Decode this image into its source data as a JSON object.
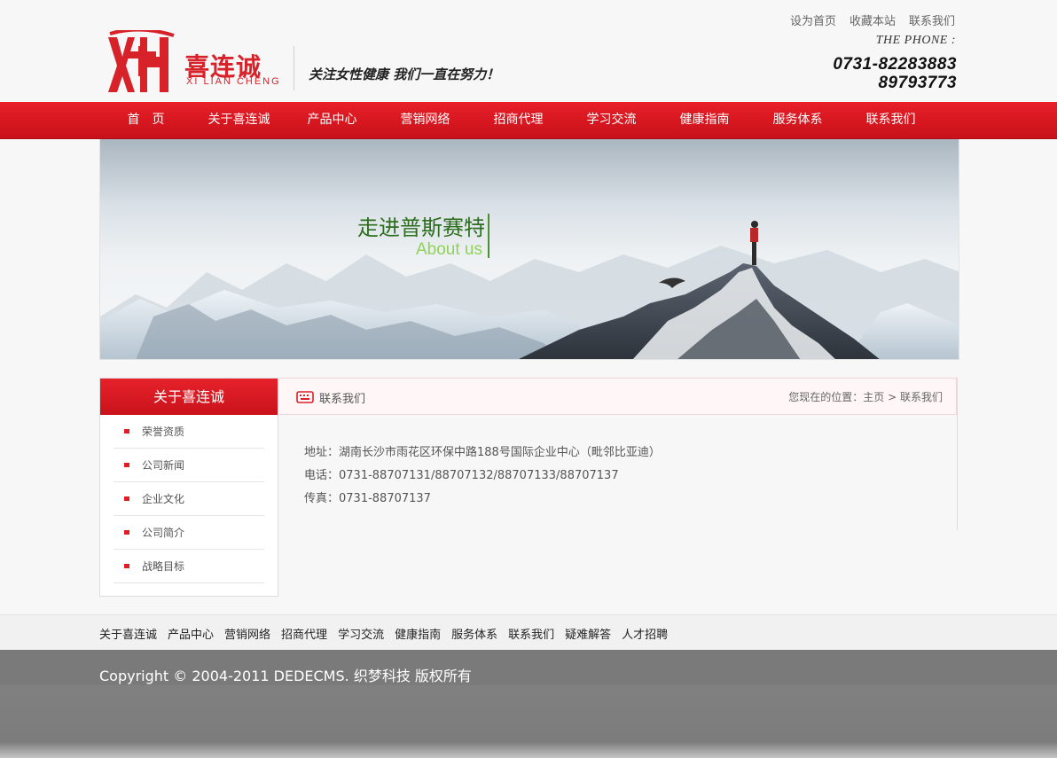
{
  "brand": {
    "name_cn": "喜连诚",
    "name_en": "XI LIAN CHENG",
    "slogan": "关注女性健康 我们一直在努力！",
    "logo_color": "#d7222a"
  },
  "top_links": [
    "设为首页",
    "收藏本站",
    "联系我们"
  ],
  "phone": {
    "label": "THE PHONE :",
    "number1": "0731-82283883",
    "number2": "89793773"
  },
  "nav": {
    "items": [
      "首　页",
      "关于喜连诚",
      "产品中心",
      "营销网络",
      "招商代理",
      "学习交流",
      "健康指南",
      "服务体系",
      "联系我们"
    ],
    "color": "#d7222a"
  },
  "banner": {
    "title": "走进普斯赛特",
    "subtitle": "About us"
  },
  "sidebar": {
    "title": "关于喜连诚",
    "items": [
      "荣誉资质",
      "公司新闻",
      "企业文化",
      "公司简介",
      "战略目标"
    ]
  },
  "content": {
    "title": "联系我们",
    "breadcrumb": {
      "prefix": "您现在的位置：",
      "home": "主页",
      "separator": ">",
      "current": "联系我们"
    },
    "lines": [
      "地址：湖南长沙市雨花区环保中路188号国际企业中心（毗邻比亚迪）",
      "电话：0731-88707131/88707132/88707133/88707137",
      "传真：0731-88707137"
    ]
  },
  "footer": {
    "links": [
      "关于喜连诚",
      "产品中心",
      "营销网络",
      "招商代理",
      "学习交流",
      "健康指南",
      "服务体系",
      "联系我们",
      "疑难解答",
      "人才招聘"
    ],
    "copyright": "Copyright © 2004-2011 DEDECMS. 织梦科技 版权所有"
  }
}
